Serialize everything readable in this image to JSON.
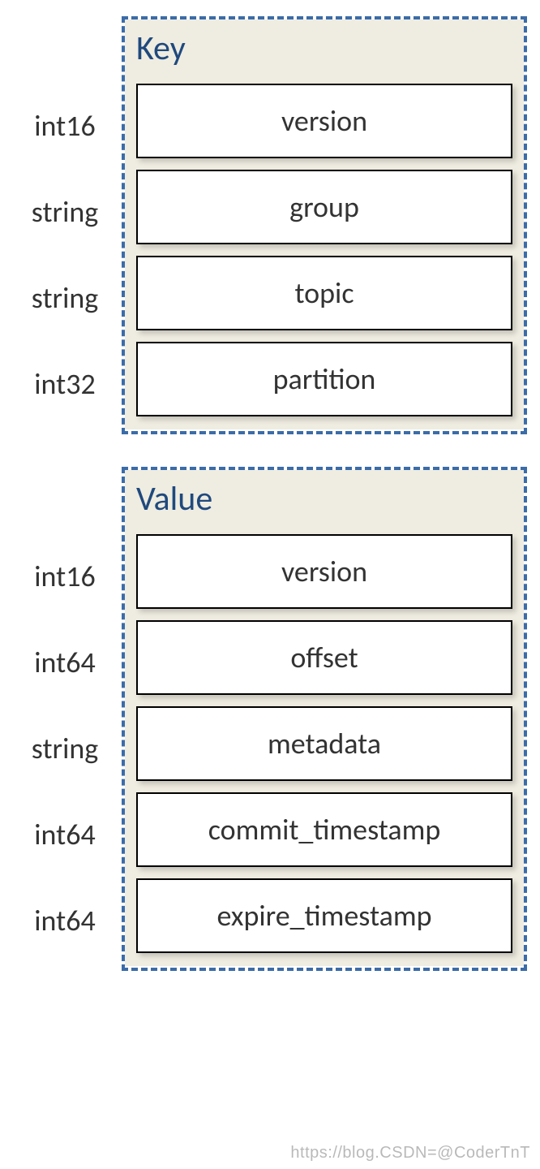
{
  "key_panel": {
    "title": "Key",
    "fields": [
      {
        "type": "int16",
        "name": "version"
      },
      {
        "type": "string",
        "name": "group"
      },
      {
        "type": "string",
        "name": "topic"
      },
      {
        "type": "int32",
        "name": "partition"
      }
    ]
  },
  "value_panel": {
    "title": "Value",
    "fields": [
      {
        "type": "int16",
        "name": "version"
      },
      {
        "type": "int64",
        "name": "offset"
      },
      {
        "type": "string",
        "name": "metadata"
      },
      {
        "type": "int64",
        "name": "commit_timestamp"
      },
      {
        "type": "int64",
        "name": "expire_timestamp"
      }
    ]
  },
  "watermark": "https://blog.CSDN=@CoderTnT"
}
